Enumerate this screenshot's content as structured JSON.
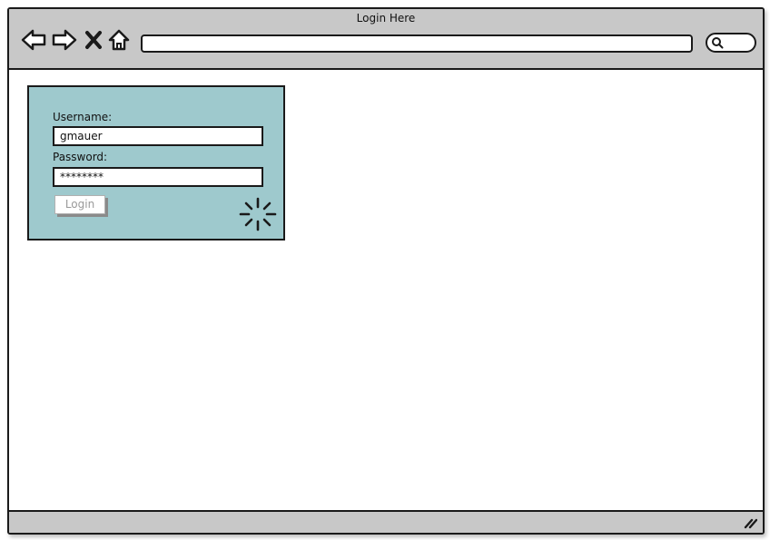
{
  "window": {
    "title": "Login Here"
  },
  "toolbar": {
    "back_icon": "back-arrow-icon",
    "forward_icon": "forward-arrow-icon",
    "stop_icon": "close-icon",
    "home_icon": "home-icon",
    "address_value": "",
    "search_icon": "search-icon"
  },
  "login_form": {
    "username_label": "Username:",
    "username_value": "gmauer",
    "password_label": "Password:",
    "password_value": "********",
    "login_label": "Login",
    "login_enabled": false,
    "spinner_icon": "loading-spinner-icon"
  },
  "colors": {
    "chrome": "#c8c8c8",
    "panel": "#9ec9cd",
    "border": "#1a1a1a",
    "disabled_text": "#9a9a9a"
  }
}
